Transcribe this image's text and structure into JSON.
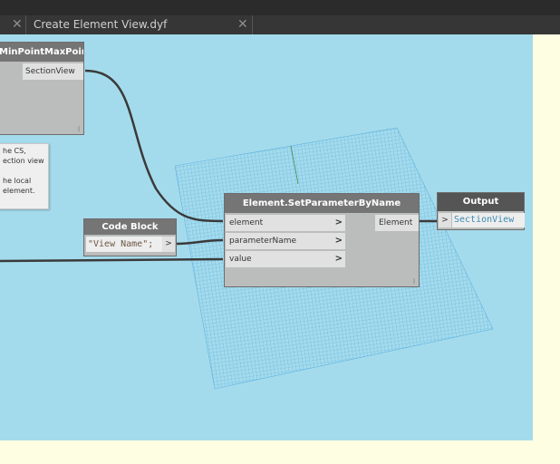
{
  "tabs": [
    {
      "label": "",
      "close": "✕"
    },
    {
      "label": "Create Element View.dyf",
      "close": "✕"
    }
  ],
  "nodes": {
    "minmax": {
      "title": "MinPointMaxPoint",
      "output": "SectionView"
    },
    "setparam": {
      "title": "Element.SetParameterByName",
      "inputs": [
        "element",
        "parameterName",
        "value"
      ],
      "output": "Element"
    },
    "codeblock": {
      "title": "Code Block",
      "code": "\"View Name\";",
      "port": ">"
    },
    "output": {
      "title": "Output",
      "port": ">",
      "value": "SectionView"
    }
  },
  "note": {
    "lines": [
      "he CS,",
      "ection view",
      "",
      "he local",
      "element."
    ]
  },
  "colors": {
    "canvas": "#a4dbec",
    "node_header": "#757575",
    "output_header": "#555555",
    "wire": "#3a3a3a",
    "grid": "#5aaee0"
  }
}
